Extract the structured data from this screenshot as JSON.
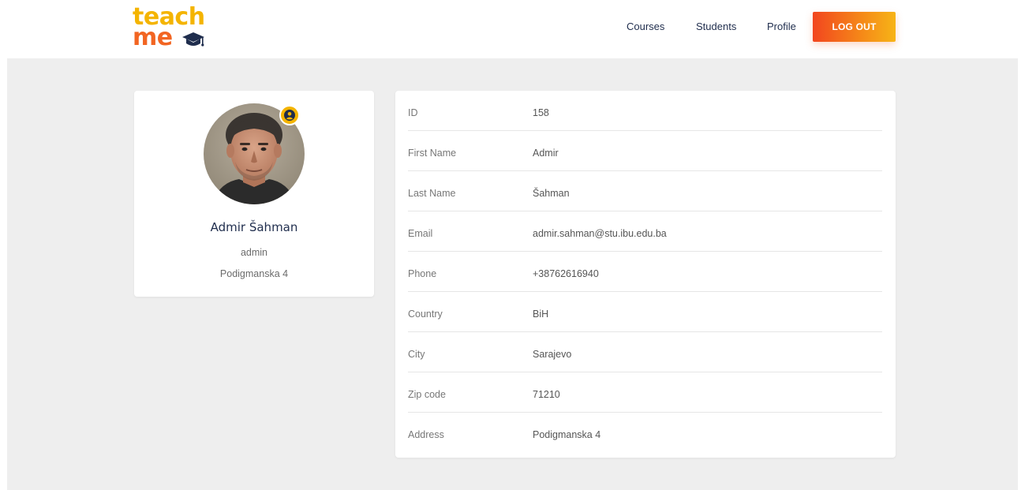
{
  "brand": {
    "line1": "teach",
    "line2": "me"
  },
  "nav": {
    "courses": "Courses",
    "students": "Students",
    "profile": "Profile",
    "logout": "LOG OUT"
  },
  "profile": {
    "name": "Admir Šahman",
    "role": "admin",
    "address": "Podigmanska 4"
  },
  "details": [
    {
      "label": "ID",
      "value": "158"
    },
    {
      "label": "First Name",
      "value": "Admir"
    },
    {
      "label": "Last Name",
      "value": "Šahman"
    },
    {
      "label": "Email",
      "value": "admir.sahman@stu.ibu.edu.ba"
    },
    {
      "label": "Phone",
      "value": "+38762616940"
    },
    {
      "label": "Country",
      "value": "BiH"
    },
    {
      "label": "City",
      "value": "Sarajevo"
    },
    {
      "label": "Zip code",
      "value": "71210"
    },
    {
      "label": "Address",
      "value": "Podigmanska 4"
    }
  ],
  "colors": {
    "brand_yellow": "#f4b400",
    "brand_orange": "#f26522",
    "nav_text": "#1f2d4d",
    "page_bg": "#eeeeee"
  }
}
